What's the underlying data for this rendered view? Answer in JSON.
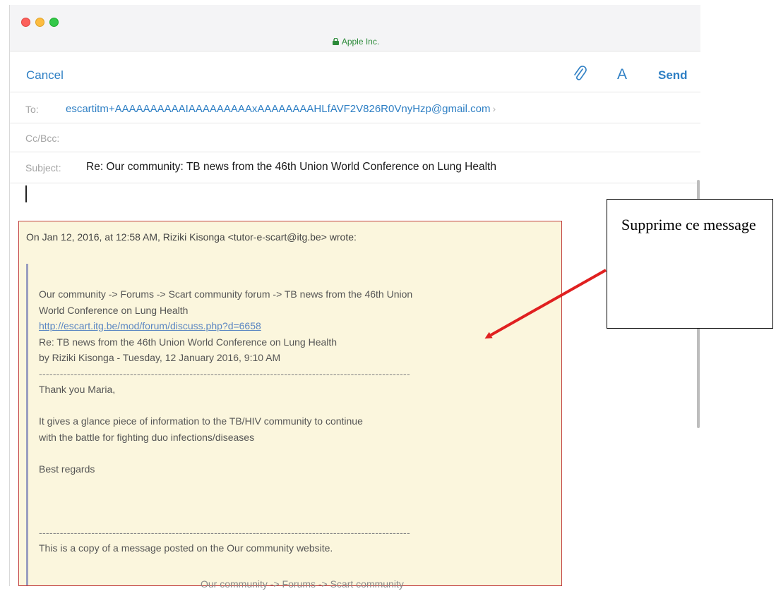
{
  "window": {
    "site_title": "Apple Inc.",
    "lock_icon": "lock-icon"
  },
  "toolbar": {
    "cancel_label": "Cancel",
    "attach_icon": "paperclip-icon",
    "font_label": "A",
    "send_label": "Send"
  },
  "compose": {
    "to_label": "To:",
    "to_value": "escartitm+AAAAAAAAAAIAAAAAAAAAxAAAAAAAAHLfAVF2V826R0VnyHzp@gmail.com",
    "to_chevron": "›",
    "cc_label": "Cc/Bcc:",
    "subject_label": "Subject:",
    "subject_value": "Re: Our community: TB news from the 46th Union World Conference on Lung Health"
  },
  "quoted": {
    "header": "On Jan 12, 2016, at 12:58 AM, Riziki Kisonga <tutor-e-scart@itg.be> wrote:",
    "breadcrumb_1": "Our community -> Forums -> Scart community forum -> TB news from the 46th Union",
    "breadcrumb_2": "World Conference on Lung Health",
    "link": "http://escart.itg.be/mod/forum/discuss.php?d=6658",
    "re_title": "Re: TB news from the 46th Union World Conference on Lung Health",
    "byline": "by Riziki Kisonga - Tuesday, 12 January 2016, 9:10 AM",
    "rule_1": "----------------------------------------------------------------------------------------------------------",
    "greeting": "Thank you Maria,",
    "body_1": "It gives a glance piece of information to the TB/HIV community to continue",
    "body_2": "with the battle for fighting duo infections/diseases",
    "signoff": "Best regards",
    "rule_2": "----------------------------------------------------------------------------------------------------------",
    "footer": "This is a copy of a message posted on the Our community website."
  },
  "behind_text": "Our community -> Forums -> Scart community",
  "annotation": {
    "text": "Supprime ce message",
    "arrow_color": "#e02020"
  }
}
